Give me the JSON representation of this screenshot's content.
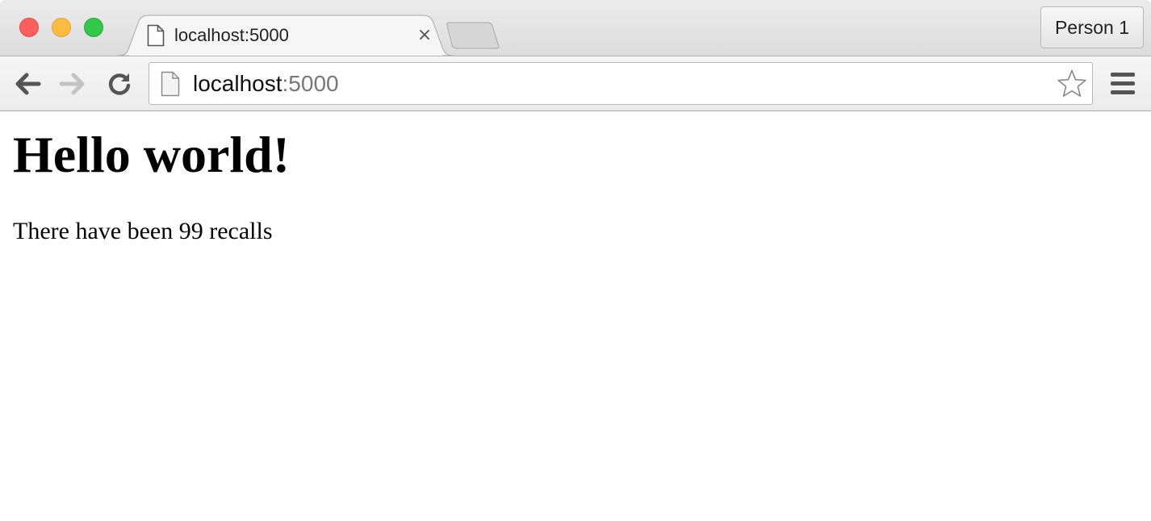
{
  "browser": {
    "tab": {
      "title": "localhost:5000",
      "close_symbol": "×",
      "page_icon": "page-icon"
    },
    "profile": {
      "label": "Person 1"
    },
    "toolbar": {
      "back_icon": "arrow-left-icon",
      "forward_icon": "arrow-right-icon",
      "reload_icon": "reload-icon",
      "menu_icon": "hamburger-menu-icon",
      "bookmark_icon": "star-icon"
    },
    "omnibox": {
      "host": "localhost",
      "port": ":5000"
    },
    "colors": {
      "close": "#fc605c",
      "minimize": "#fdbc40",
      "maximize": "#34c84a"
    }
  },
  "page": {
    "heading": "Hello world!",
    "paragraph": "There have been 99 recalls"
  }
}
